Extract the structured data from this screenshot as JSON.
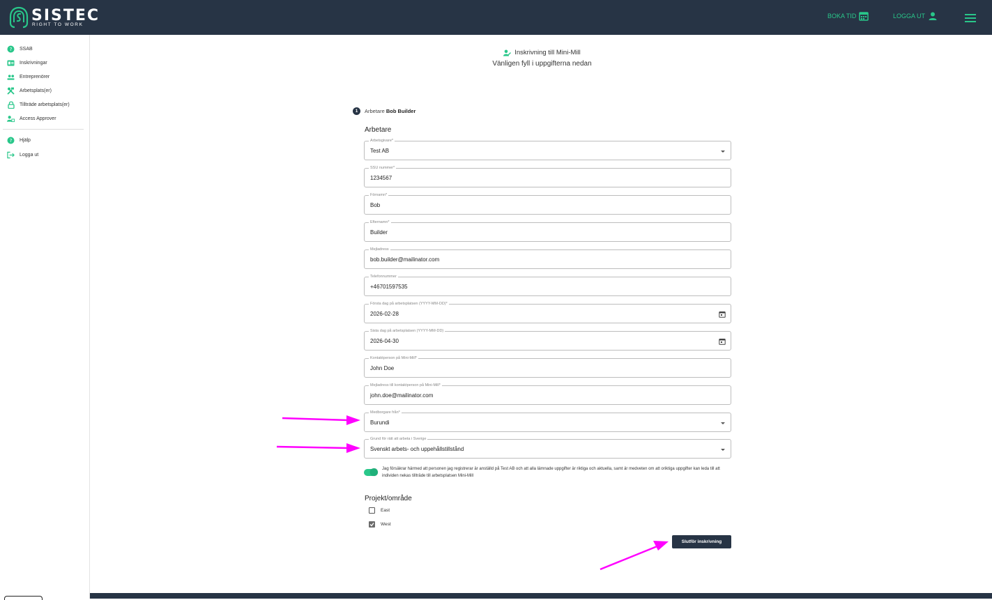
{
  "colors": {
    "topbar": "#273445",
    "accent": "#29c78a",
    "annotation_arrow": "#ff00ff"
  },
  "topbar": {
    "logo_text": "SISTEC",
    "logo_sub": "RIGHT TO WORK",
    "book_label": "BOKA TID",
    "logout_label": "LOGGA UT"
  },
  "sidebar": {
    "items": [
      {
        "label": "SSAB",
        "icon": "help-circle-icon"
      },
      {
        "label": "Inskrivningar",
        "icon": "id-card-icon"
      },
      {
        "label": "Entreprenörer",
        "icon": "people-icon"
      },
      {
        "label": "Arbetsplats(er)",
        "icon": "tools-icon"
      },
      {
        "label": "Tillträde arbetsplats(er)",
        "icon": "lock-icon"
      },
      {
        "label": "Access Approver",
        "icon": "user-check-icon"
      }
    ],
    "bottom_items": [
      {
        "label": "Hjälp",
        "icon": "help-circle-icon"
      },
      {
        "label": "Logga ut",
        "icon": "logout-icon"
      }
    ]
  },
  "header": {
    "title": "Inskrivning till Mini-Mill",
    "subtitle": "Vänligen fyll i uppgifterna nedan"
  },
  "step": {
    "number": "1",
    "prefix": "Arbetare",
    "name": "Bob Builder"
  },
  "form": {
    "section_title": "Arbetare",
    "fields": [
      {
        "label": "Arbetsgivare*",
        "value": "Test AB",
        "kind": "select"
      },
      {
        "label": "SSU nummer*",
        "value": "1234567",
        "kind": "text"
      },
      {
        "label": "Förnamn*",
        "value": "Bob",
        "kind": "text"
      },
      {
        "label": "Efternamn*",
        "value": "Builder",
        "kind": "text"
      },
      {
        "label": "Mejladress",
        "value": "bob.builder@mailinator.com",
        "kind": "text"
      },
      {
        "label": "Telefonnummer",
        "value": "+46701597535",
        "kind": "text"
      },
      {
        "label": "Första dag på arbetsplatsen (YYYY-MM-DD)*",
        "value": "2026-02-28",
        "kind": "date"
      },
      {
        "label": "Sista dag på arbetsplatsen (YYYY-MM-DD)",
        "value": "2026-04-30",
        "kind": "date"
      },
      {
        "label": "Kontaktperson på Mini-Mill*",
        "value": "John Doe",
        "kind": "text"
      },
      {
        "label": "Mejladress till kontaktperson på Mini-Mill*",
        "value": "john.doe@mailinator.com",
        "kind": "text"
      },
      {
        "label": "Medborgare från*",
        "value": "Burundi",
        "kind": "select"
      },
      {
        "label": "Grund för rätt att arbeta i Sverige",
        "value": "Svenskt arbets- och uppehållstillstånd",
        "kind": "select"
      }
    ],
    "consent_text": "Jag försäkrar härmed att personen jag registrerar är anställd på Test AB och att alla lämnade uppgifter är riktiga och aktuella, samt är medveten om att oriktiga uppgifter kan leda till att individen nekas tillträde till arbetsplatsen Mini-Mill",
    "consent_checked": true,
    "project_title": "Projekt/område",
    "projects": [
      {
        "label": "East",
        "checked": false
      },
      {
        "label": "West",
        "checked": true
      }
    ],
    "submit_label": "Slutför inskrivning"
  }
}
